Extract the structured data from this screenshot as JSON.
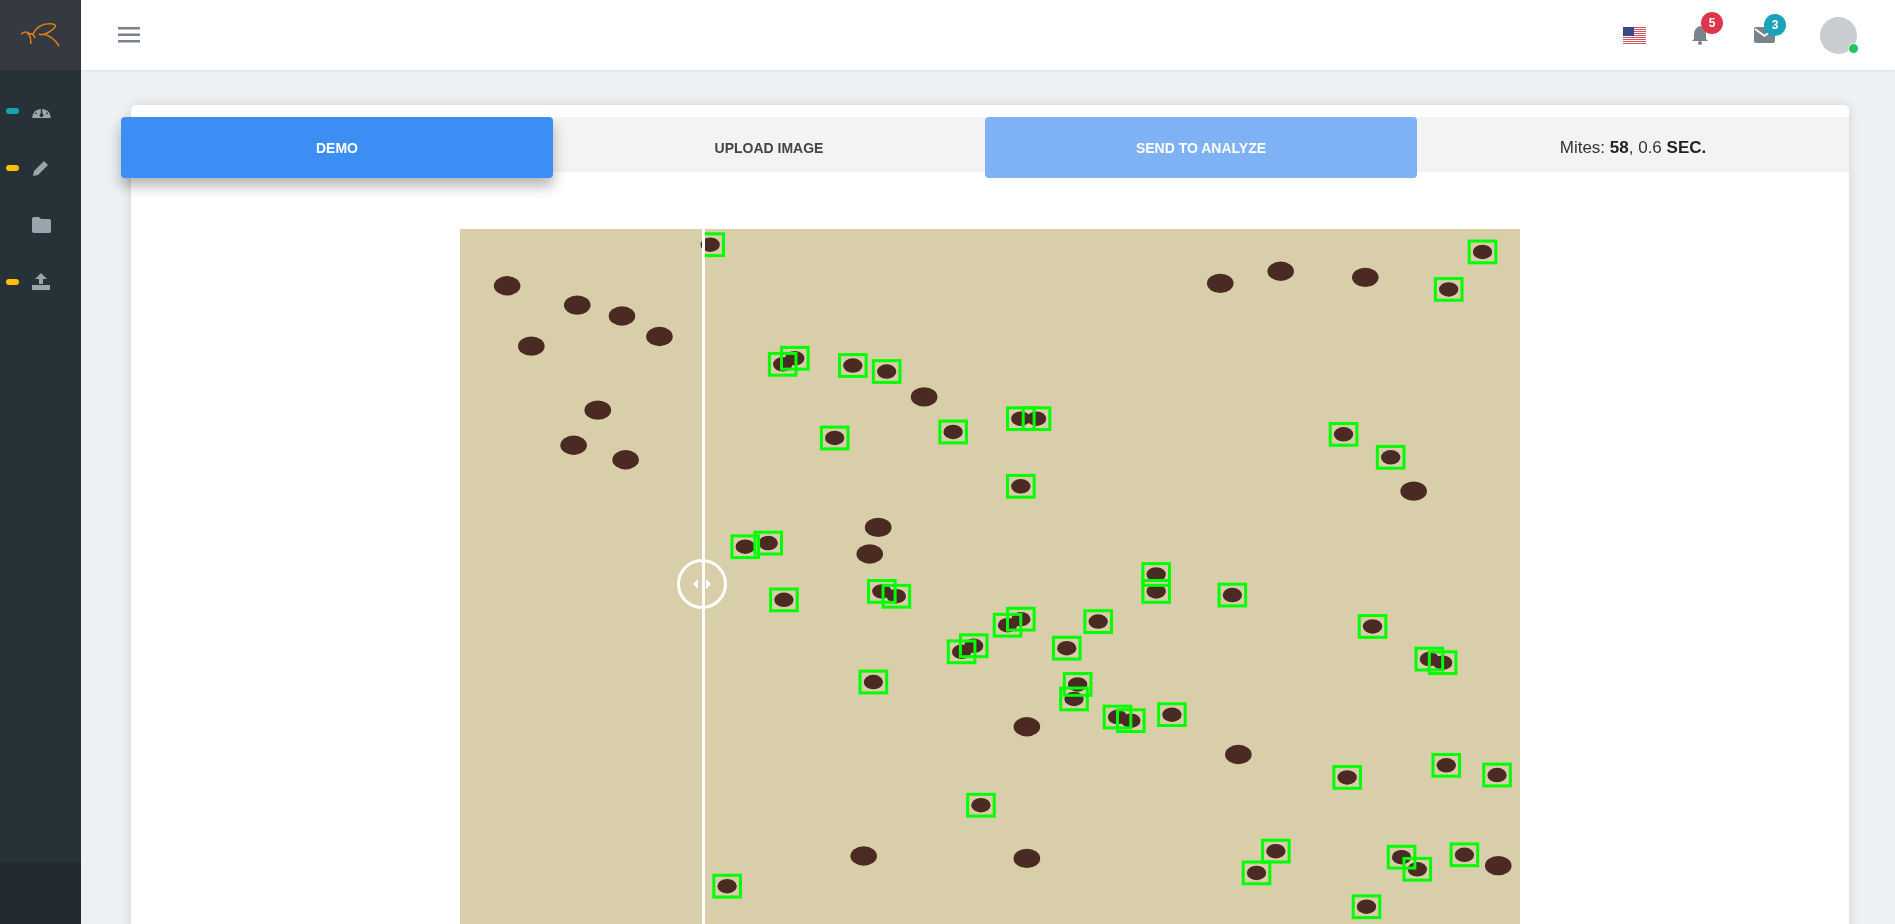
{
  "sidebar": {
    "items": [
      {
        "kind": "dashboard",
        "color": "#17a2b8"
      },
      {
        "kind": "edit",
        "color": "#ffc107"
      },
      {
        "kind": "folder"
      },
      {
        "kind": "upload",
        "color": "#ffc107"
      }
    ]
  },
  "header": {
    "notifications": {
      "count": "5"
    },
    "messages": {
      "count": "3"
    },
    "user": {
      "online": true
    }
  },
  "tabs": [
    {
      "label": "DEMO",
      "selected": true,
      "disabled": false
    },
    {
      "label": "UPLOAD IMAGE",
      "selected": false,
      "disabled": false
    },
    {
      "label": "SEND TO ANALYZE",
      "selected": false,
      "disabled": true
    }
  ],
  "result": {
    "text": "Mites: **58**, 0.6 **SEC.**"
  },
  "comparison": {
    "level": 0.23
  }
}
